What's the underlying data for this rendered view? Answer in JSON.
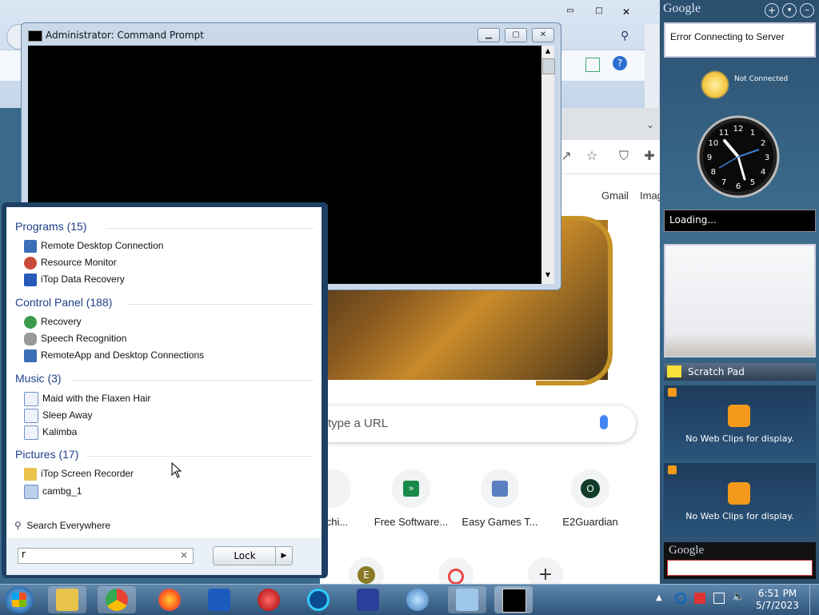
{
  "cmd": {
    "title": "Administrator: Command Prompt"
  },
  "chrome": {
    "links": {
      "gmail": "Gmail",
      "images": "Images"
    },
    "omnibox_placeholder": "type a URL",
    "tiles": [
      {
        "label": "Archi..."
      },
      {
        "label": "Free Software...",
        "letter": ""
      },
      {
        "label": "Easy Games T..."
      },
      {
        "label": "E2Guardian",
        "letter": "O"
      }
    ],
    "row2_letter": "E",
    "add_symbol": "+"
  },
  "start_menu": {
    "groups": [
      {
        "title": "Programs (15)",
        "items": [
          "Remote Desktop Connection",
          "Resource Monitor",
          "iTop Data Recovery"
        ]
      },
      {
        "title": "Control Panel (188)",
        "items": [
          "Recovery",
          "Speech Recognition",
          "RemoteApp and Desktop Connections"
        ]
      },
      {
        "title": "Music (3)",
        "items": [
          "Maid with the Flaxen Hair",
          "Sleep Away",
          "Kalimba"
        ]
      },
      {
        "title": "Pictures (17)",
        "items": [
          "iTop Screen Recorder",
          "cambg_1"
        ]
      }
    ],
    "search_everywhere": "Search Everywhere",
    "search_value": "r",
    "clear_symbol": "×",
    "lock_label": "Lock",
    "lock_arrow": "▶"
  },
  "sidebar": {
    "brand": "Google",
    "google_error": "Error Connecting to Server",
    "weather_status": "Not Connected",
    "clock_numbers": [
      "12",
      "1",
      "2",
      "3",
      "4",
      "5",
      "6",
      "7",
      "8",
      "9",
      "10",
      "11"
    ],
    "loading": "Loading...",
    "scratch_pad": "Scratch Pad",
    "webclips1": "No Web Clips for display.",
    "webclips2": "No Web Clips for display.",
    "search_brand": "Google"
  },
  "taskbar": {
    "time": "6:51 PM",
    "date": "5/7/2023"
  },
  "colors": {
    "start_blue": "#1e3f63",
    "group_title": "#1e3f8a",
    "rss_orange": "#f39a1b"
  }
}
